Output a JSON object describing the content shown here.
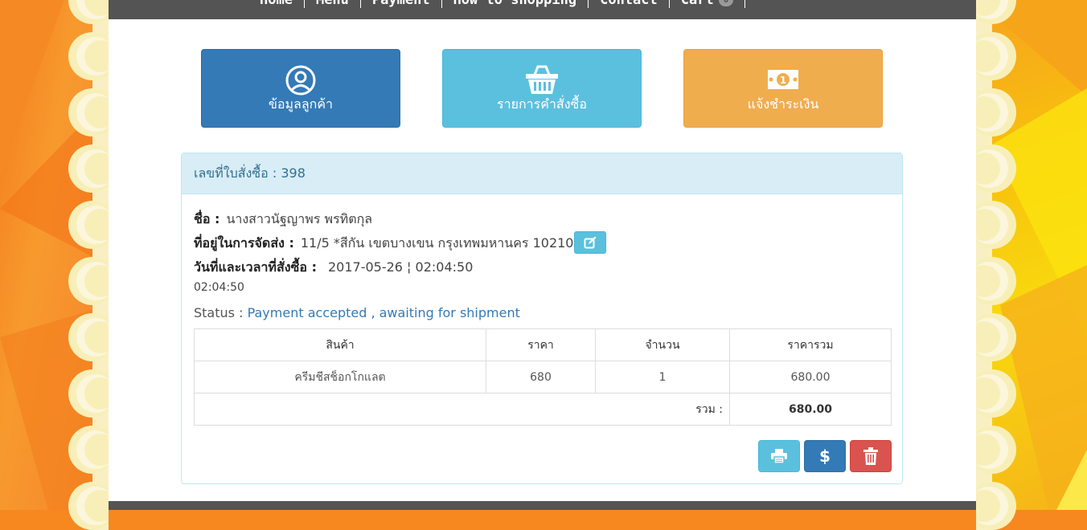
{
  "nav": {
    "items": [
      {
        "label": "Home"
      },
      {
        "label": "Menu"
      },
      {
        "label": "Payment"
      },
      {
        "label": "How to shopping"
      },
      {
        "label": "Contact"
      },
      {
        "label": "Cart"
      }
    ],
    "cart_count": "0"
  },
  "tiles": {
    "customer": "ข้อมูลลูกค้า",
    "orders": "รายการคำสั่งซื้อ",
    "payment": "แจ้งชำระเงิน"
  },
  "order": {
    "header": "เลขที่ใบสั่งซื้อ : 398",
    "name_label": "ชื่อ :",
    "name_value": "นางสาวนัฐญาพร พรทิตกุล",
    "address_label": "ที่อยู่ในการจัดส่ง :",
    "address_value": "11/5 *สีกัน เขตบางเขน กรุงเทพมหานคร 10210",
    "date_label": "วันที่และเวลาที่สั่งซื้อ :",
    "date_value": "2017-05-26 ¦ 02:04:50",
    "time_extra": "02:04:50",
    "status_label": "Status :",
    "status_value": "Payment accepted , awaiting for shipment"
  },
  "table": {
    "headers": [
      "สินค้า",
      "ราคา",
      "จำนวน",
      "ราคารวม"
    ],
    "rows": [
      {
        "product": "ครีมชีสช็อกโกแลต",
        "price": "680",
        "qty": "1",
        "total": "680.00"
      }
    ],
    "sum_label": "รวม :",
    "sum_value": "680.00"
  },
  "icons": {
    "customer": "user-circle-icon",
    "orders": "basket-icon",
    "payment": "money-icon",
    "edit": "edit-icon",
    "print": "print-icon",
    "pay": "dollar-icon",
    "delete": "trash-icon"
  },
  "colors": {
    "primary": "#337ab7",
    "info": "#5bc0de",
    "warning": "#f0ad4e",
    "danger": "#d9534f",
    "nav": "#545454"
  }
}
